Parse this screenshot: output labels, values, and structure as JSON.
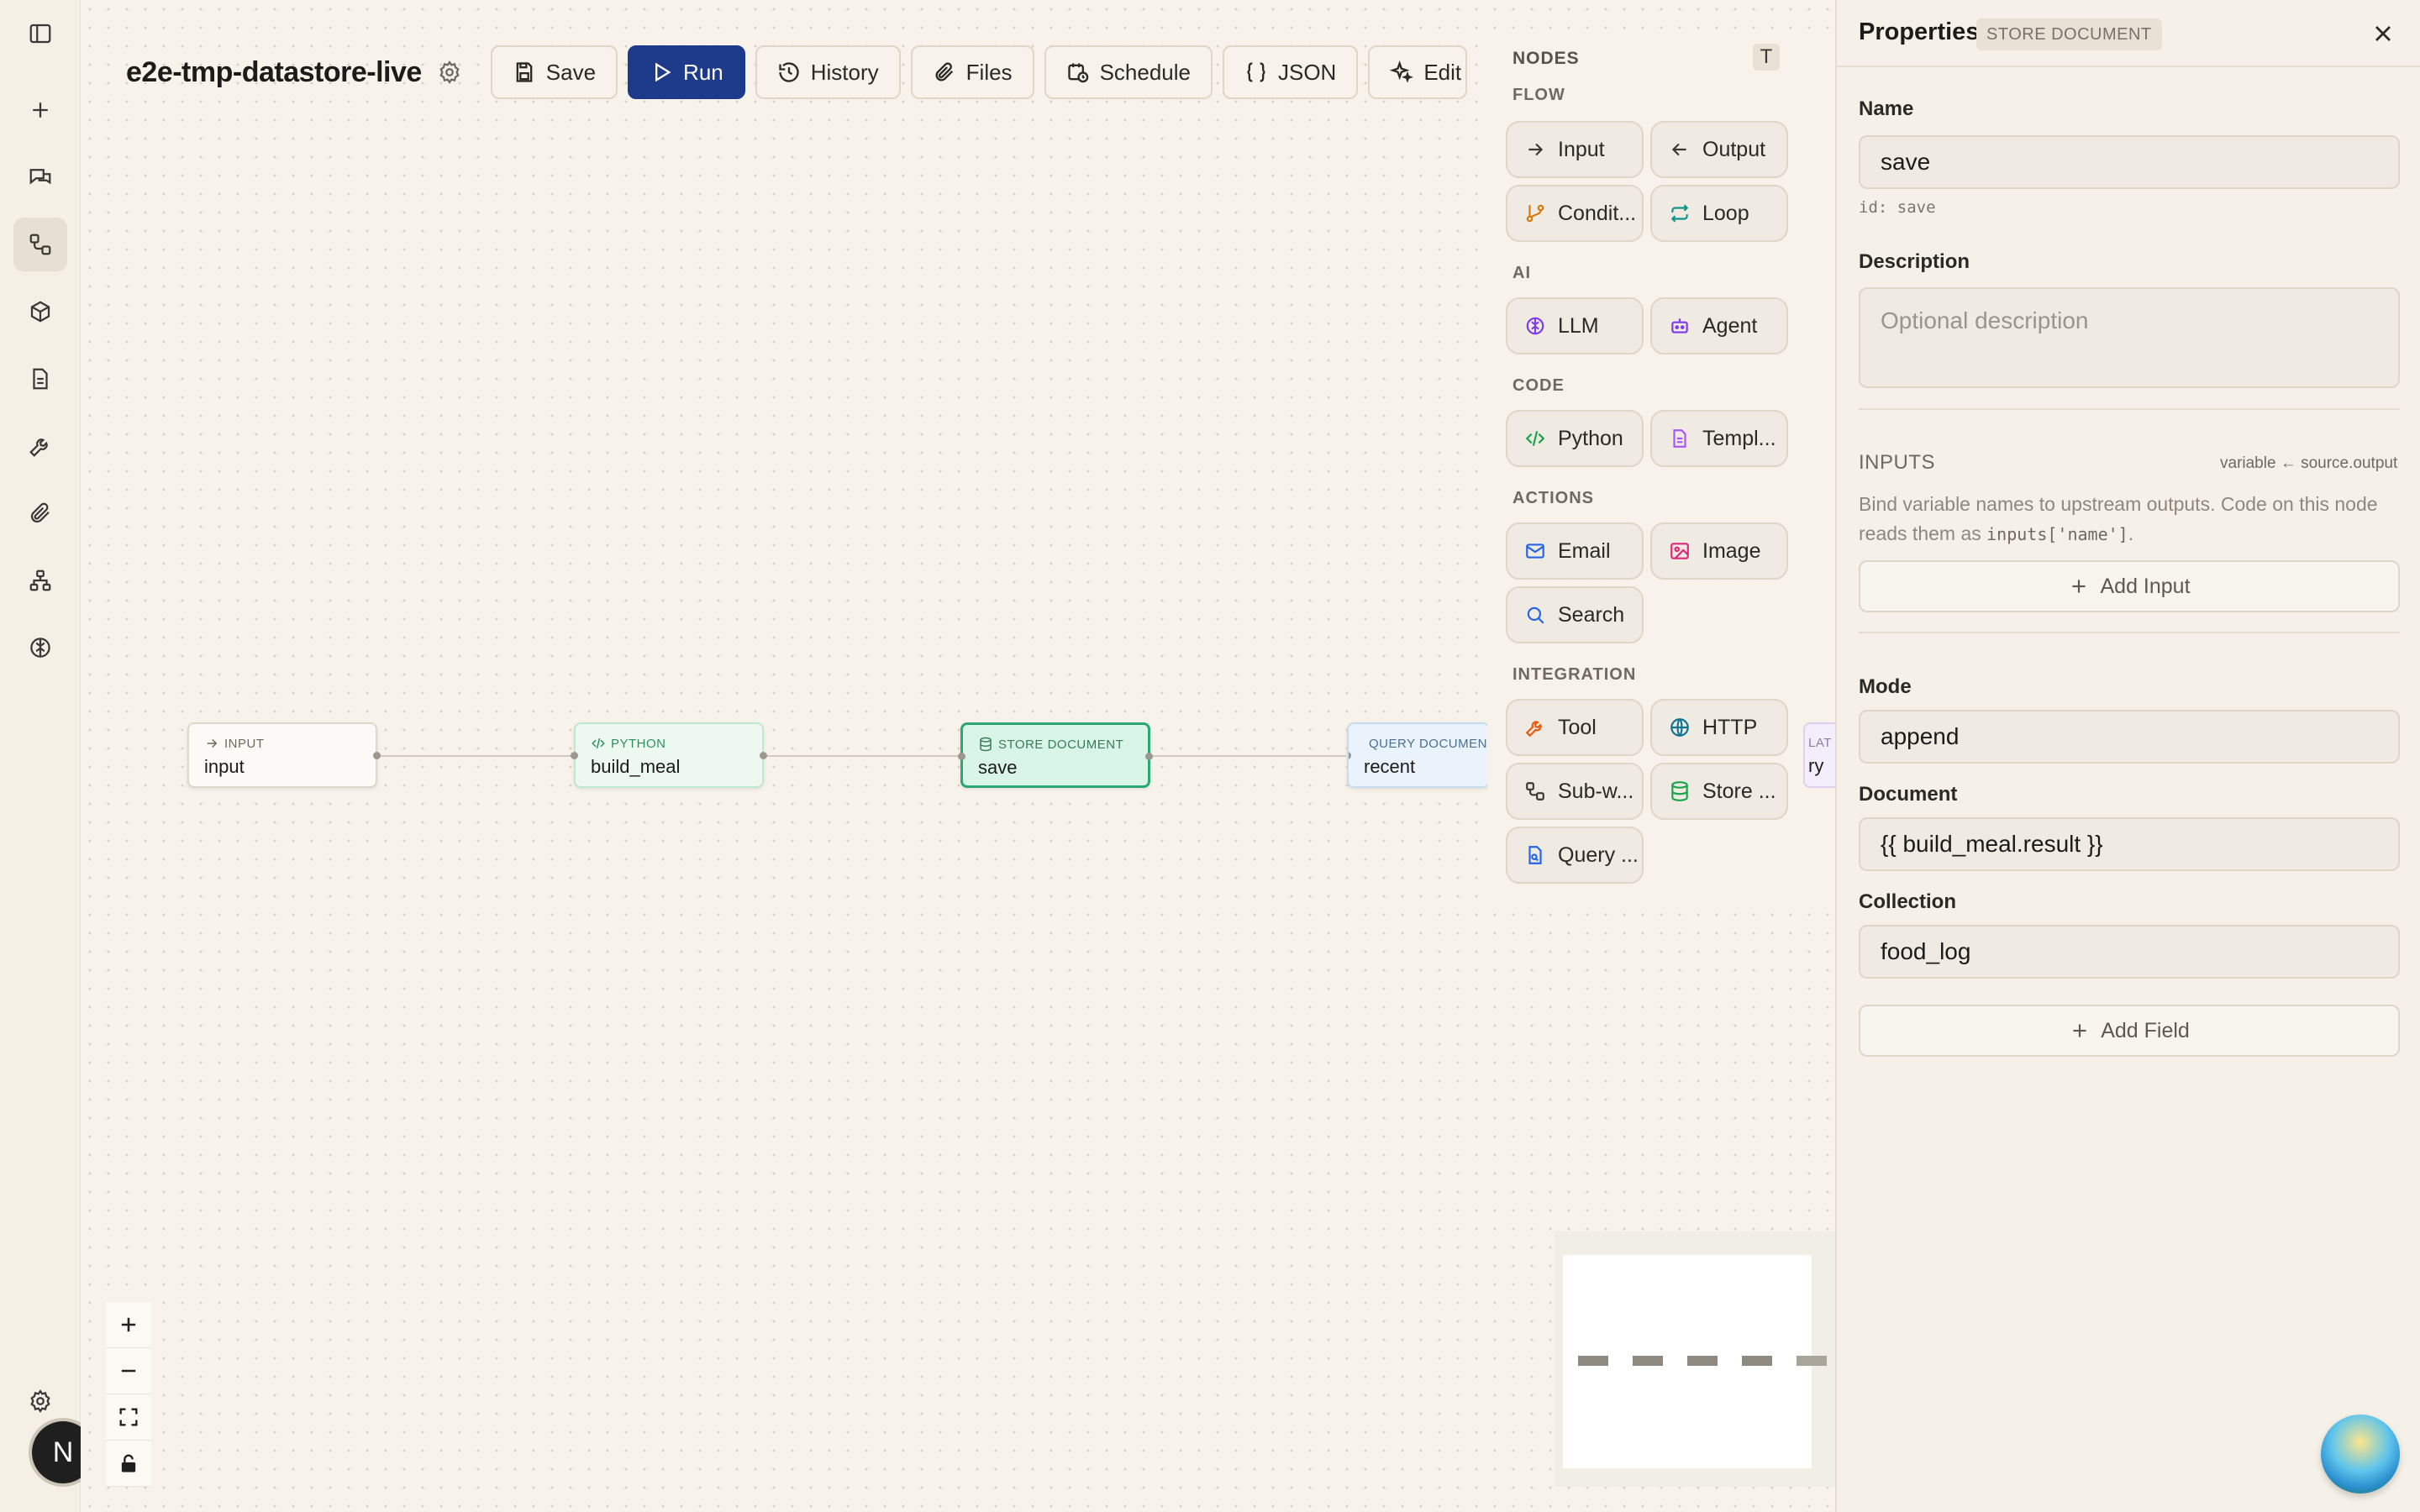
{
  "workflow": {
    "title": "e2e-tmp-datastore-live"
  },
  "toolbar": {
    "save": "Save",
    "run": "Run",
    "history": "History",
    "files": "Files",
    "schedule": "Schedule",
    "json": "JSON",
    "edit": "Edit"
  },
  "sidebar": {
    "items": [
      "toggle-sidebar",
      "new",
      "chats",
      "workflows",
      "packages",
      "documents",
      "tools",
      "attachments",
      "org-chart",
      "brain"
    ],
    "active": "workflows",
    "settings_icon": "gear-icon",
    "avatar_initial": "N"
  },
  "nodes": [
    {
      "type": "INPUT",
      "name": "input"
    },
    {
      "type": "PYTHON",
      "name": "build_meal"
    },
    {
      "type": "STORE DOCUMENT",
      "name": "save",
      "selected": true
    },
    {
      "type": "QUERY DOCUMENT",
      "name": "recent"
    },
    {
      "type": "LAT",
      "name": "ry"
    }
  ],
  "palette": {
    "title": "NODES",
    "toggle_label": "T",
    "sections": {
      "flow": {
        "label": "FLOW",
        "items": [
          "Input",
          "Output",
          "Condit...",
          "Loop"
        ]
      },
      "ai": {
        "label": "AI",
        "items": [
          "LLM",
          "Agent"
        ]
      },
      "code": {
        "label": "CODE",
        "items": [
          "Python",
          "Templ..."
        ]
      },
      "actions": {
        "label": "ACTIONS",
        "items": [
          "Email",
          "Image",
          "Search"
        ]
      },
      "integration": {
        "label": "INTEGRATION",
        "items": [
          "Tool",
          "HTTP",
          "Sub-w...",
          "Store ...",
          "Query ..."
        ]
      }
    }
  },
  "properties": {
    "title": "Properties",
    "badge": "STORE DOCUMENT",
    "name_label": "Name",
    "name_value": "save",
    "id_text": "id: save",
    "description_label": "Description",
    "description_placeholder": "Optional description",
    "inputs_title": "INPUTS",
    "inputs_hint": "variable ← source.output",
    "inputs_desc_1": "Bind variable names to upstream outputs. Code on this node reads them as ",
    "inputs_desc_code": "inputs['name']",
    "inputs_desc_2": ".",
    "add_input": "Add Input",
    "mode_label": "Mode",
    "mode_value": "append",
    "document_label": "Document",
    "document_value": "{{ build_meal.result }}",
    "collection_label": "Collection",
    "collection_value": "food_log",
    "add_field": "Add Field"
  },
  "colors": {
    "accent": "#1e3a8a",
    "selected_node_border": "#2aa876",
    "canvas_bg": "#f7f3ea"
  }
}
